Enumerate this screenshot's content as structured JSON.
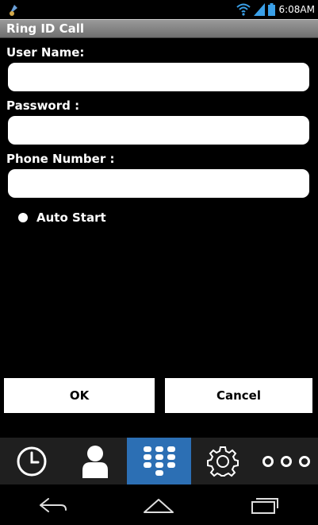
{
  "status_bar": {
    "time": "6:08AM"
  },
  "app": {
    "title": "Ring ID Call"
  },
  "form": {
    "user_name_label": "User Name:",
    "password_label": "Password :",
    "phone_label": "Phone Number :",
    "user_name_value": "",
    "password_value": "",
    "phone_value": "",
    "auto_start_label": "Auto Start"
  },
  "buttons": {
    "ok": "OK",
    "cancel": "Cancel"
  },
  "tabs": [
    "history",
    "contacts",
    "dialpad",
    "settings",
    "more"
  ],
  "active_tab": "dialpad",
  "colors": {
    "accent": "#2c6fb4",
    "titlebar": "#808080"
  }
}
